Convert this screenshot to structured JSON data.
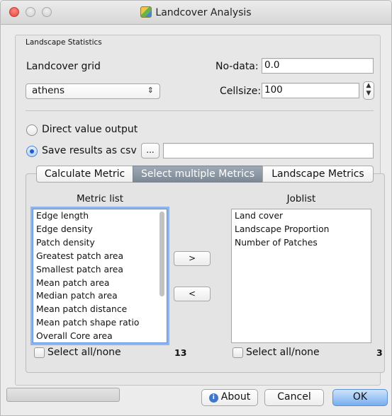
{
  "window": {
    "title": "Landcover Analysis"
  },
  "panel": {
    "title": "Landscape Statistics"
  },
  "landcover": {
    "label": "Landcover grid",
    "value": "athens"
  },
  "nodata": {
    "label": "No-data:",
    "value": "0.0"
  },
  "cellsize": {
    "label": "Cellsize:",
    "value": "100"
  },
  "output": {
    "direct_label": "Direct value output",
    "csv_label": "Save results as csv",
    "browse_label": "...",
    "csv_path": "",
    "selected": "csv"
  },
  "tabs": [
    {
      "label": "Calculate Metric",
      "active": false
    },
    {
      "label": "Select multiple Metrics",
      "active": true
    },
    {
      "label": "Landscape Metrics",
      "active": false
    }
  ],
  "metric_list": {
    "heading": "Metric list",
    "items": [
      "Edge length",
      "Edge density",
      "Patch density",
      "Greatest patch area",
      "Smallest patch area",
      "Mean patch area",
      "Median patch area",
      "Mean patch distance",
      "Mean patch shape ratio",
      "Overall Core area"
    ],
    "select_all_label": "Select all/none",
    "count": "13"
  },
  "joblist": {
    "heading": "Joblist",
    "items": [
      "Land cover",
      "Landscape Proportion",
      "Number of Patches"
    ],
    "select_all_label": "Select all/none",
    "count": "3"
  },
  "transfer": {
    "add_label": ">",
    "remove_label": "<"
  },
  "footer": {
    "about_label": "About",
    "cancel_label": "Cancel",
    "ok_label": "OK",
    "progress": 0
  },
  "icons": {
    "window_icon": "landcover-app-icon",
    "about_icon": "info-icon"
  },
  "colors": {
    "accent": "#3f7fd8",
    "active_tab": "#7d8896"
  }
}
